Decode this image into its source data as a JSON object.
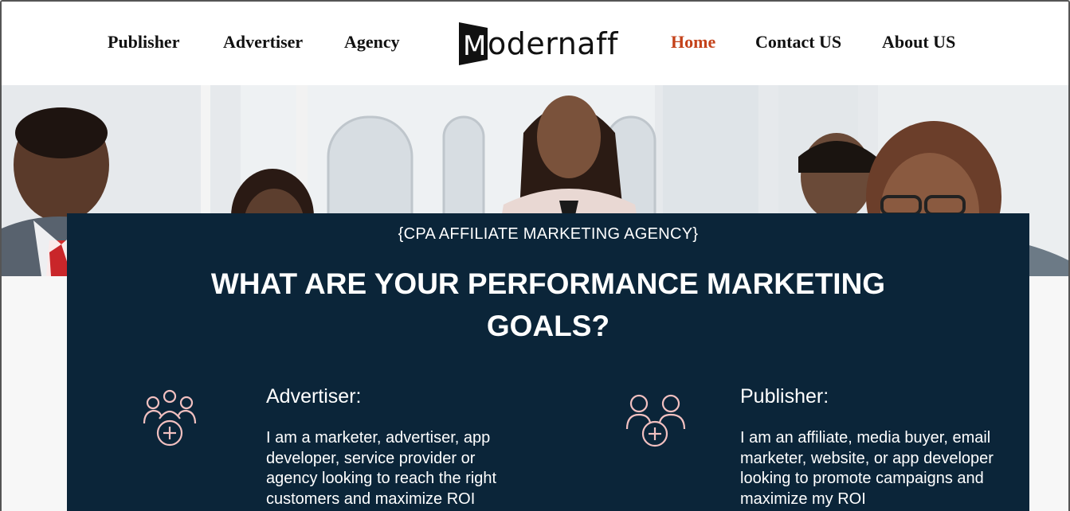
{
  "nav": {
    "left": [
      "Publisher",
      "Advertiser",
      "Agency"
    ],
    "right": [
      "Home",
      "Contact US",
      "About US"
    ],
    "active": "Home"
  },
  "logo": {
    "text": "odernaff",
    "mark": "M"
  },
  "hero": {
    "kicker": "{CPA AFFILIATE MARKETING AGENCY}",
    "headline": "WHAT ARE YOUR PERFORMANCE MARKETING GOALS?"
  },
  "services": [
    {
      "icon": "group-plus-icon",
      "title": "Advertiser:",
      "description": "I am a marketer, advertiser, app developer, service provider or agency looking to reach the right customers and maximize ROI"
    },
    {
      "icon": "pair-plus-icon",
      "title": "Publisher:",
      "description": "I am an affiliate, media buyer, email marketer, website, or app developer looking to promote campaigns and maximize my ROI"
    }
  ],
  "colors": {
    "accent": "#c4421a",
    "panel": "#0b2539",
    "icon": "#f2c0c0"
  }
}
